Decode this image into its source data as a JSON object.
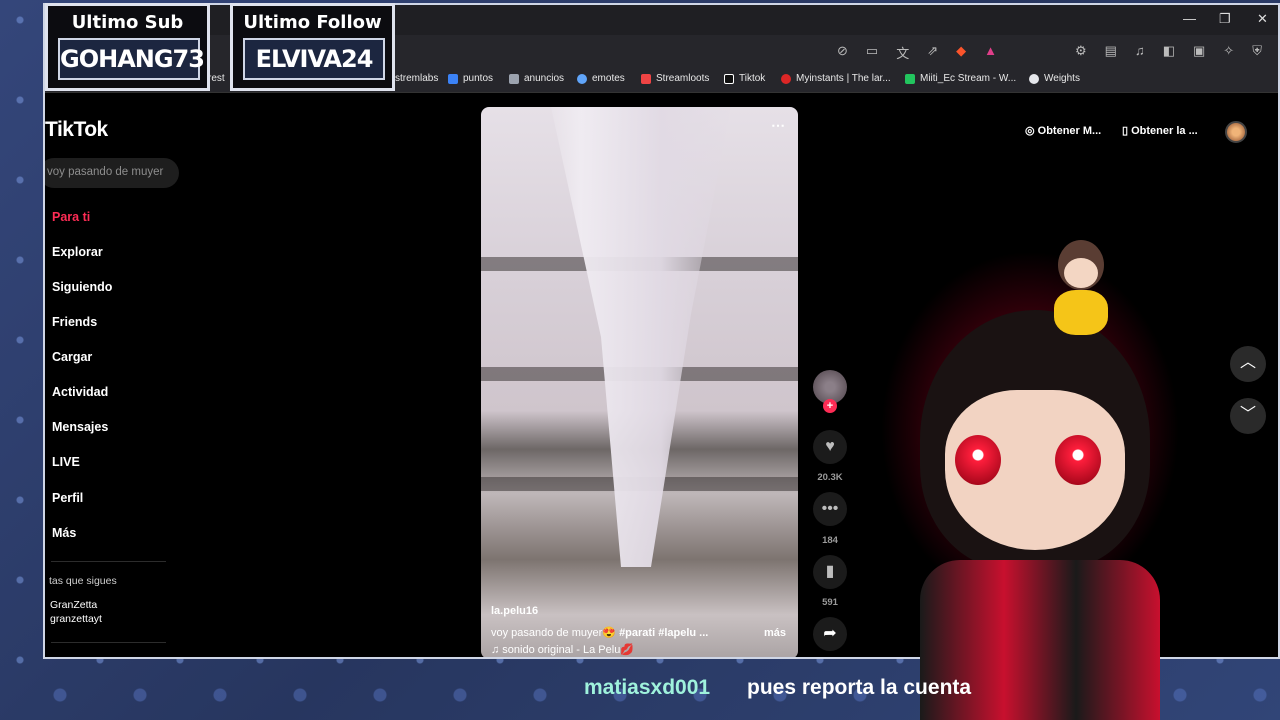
{
  "overlay": {
    "sub": {
      "title": "Ultimo Sub",
      "name": "GOHANG73"
    },
    "follow": {
      "title": "Ultimo Follow",
      "name": "ELVIVA24"
    }
  },
  "browser": {
    "window_controls": [
      "—",
      "❐",
      "✕"
    ],
    "toolbar_icons": [
      "privacy-icon",
      "cast-icon",
      "translate-icon",
      "share-icon",
      "brave-shield-icon",
      "rewards-icon"
    ],
    "bookmarks": [
      {
        "label": "rest",
        "color": "#444"
      },
      {
        "label": "stremlabs",
        "color": "#80f5d2"
      },
      {
        "label": "puntos",
        "color": "#3b82f6"
      },
      {
        "label": "anuncios",
        "color": "#9ca3af"
      },
      {
        "label": "emotes",
        "color": "#60a5fa"
      },
      {
        "label": "Streamloots",
        "color": "#ef4444"
      },
      {
        "label": "Tiktok",
        "color": "#ffffff"
      },
      {
        "label": "Myinstants | The lar...",
        "color": "#dc2626"
      },
      {
        "label": "Miiti_Ec Stream - W...",
        "color": "#22c55e"
      },
      {
        "label": "Weights",
        "color": "#e5e7eb"
      }
    ]
  },
  "tiktok": {
    "logo": "TikTok",
    "search_placeholder": "voy pasando de muyer",
    "nav": [
      "Para ti",
      "Explorar",
      "Siguiendo",
      "Friends",
      "Cargar",
      "Actividad",
      "Mensajes",
      "LIVE",
      "Perfil",
      "Más"
    ],
    "following_header": "tas que sigues",
    "following_user": {
      "display": "GranZetta",
      "handle": "granzettayt"
    },
    "top_buttons": [
      "Obtener M...",
      "Obtener la ..."
    ],
    "video": {
      "username": "la.pelu16",
      "description": "voy pasando de muyer😍",
      "tag1": "#parati",
      "tag2": "#lapelu ...",
      "more": "más",
      "sound": "♫  sonido original - La Pelu💋"
    },
    "actions": {
      "likes": "20.3K",
      "comments": "184",
      "saves": "591"
    }
  },
  "chat": {
    "user": "matiasxd001",
    "message": "pues reporta la cuenta"
  }
}
